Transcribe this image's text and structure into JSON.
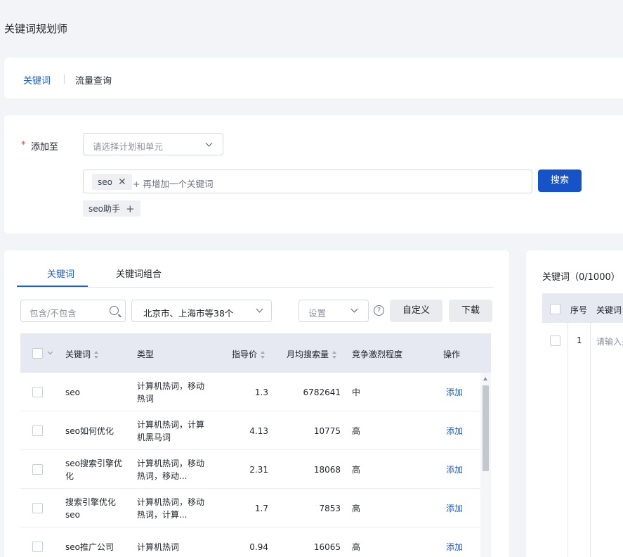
{
  "page_title": "关键词规划师",
  "nav": {
    "active": "关键词",
    "other": "流量查询"
  },
  "form": {
    "add_to_label": "添加至",
    "required_mark": "*",
    "plan_select_placeholder": "请选择计划和单元",
    "keyword_tag": "seo",
    "add_more_placeholder": "+ 再增加一个关键词",
    "search_button": "搜索",
    "helper_tag": "seo助手"
  },
  "list": {
    "tabs": [
      "关键词",
      "关键词组合"
    ],
    "filter_placeholder": "包含/不包含",
    "region_value": "北京市、上海市等38个",
    "settings_placeholder": "设置",
    "help_glyph": "?",
    "custom_button": "自定义",
    "download_button": "下载",
    "columns": [
      "关键词",
      "类型",
      "指导价",
      "月均搜索量",
      "竞争激烈程度",
      "操作"
    ],
    "rows": [
      {
        "keyword": "seo",
        "type": "计算机热词，移动热词",
        "price": "1.3",
        "volume": "6782641",
        "competition": "中",
        "action": "添加"
      },
      {
        "keyword": "seo如何优化",
        "type": "计算机热词，计算机黑马词",
        "price": "4.13",
        "volume": "10775",
        "competition": "高",
        "action": "添加"
      },
      {
        "keyword": "seo搜索引擎优化",
        "type": "计算机热词，移动热词，移动...",
        "price": "2.31",
        "volume": "18068",
        "competition": "高",
        "action": "添加"
      },
      {
        "keyword": "搜索引擎优化seo",
        "type": "计算机热词，移动热词，计算...",
        "price": "1.7",
        "volume": "7853",
        "competition": "高",
        "action": "添加"
      },
      {
        "keyword": "seo推广公司",
        "type": "计算机热词",
        "price": "0.94",
        "volume": "16065",
        "competition": "高",
        "action": "添加"
      }
    ]
  },
  "selected": {
    "title": "关键词（0/1000）",
    "columns": [
      "序号",
      "关键词"
    ],
    "row_number": "1",
    "row_placeholder": "请输入关键词"
  }
}
